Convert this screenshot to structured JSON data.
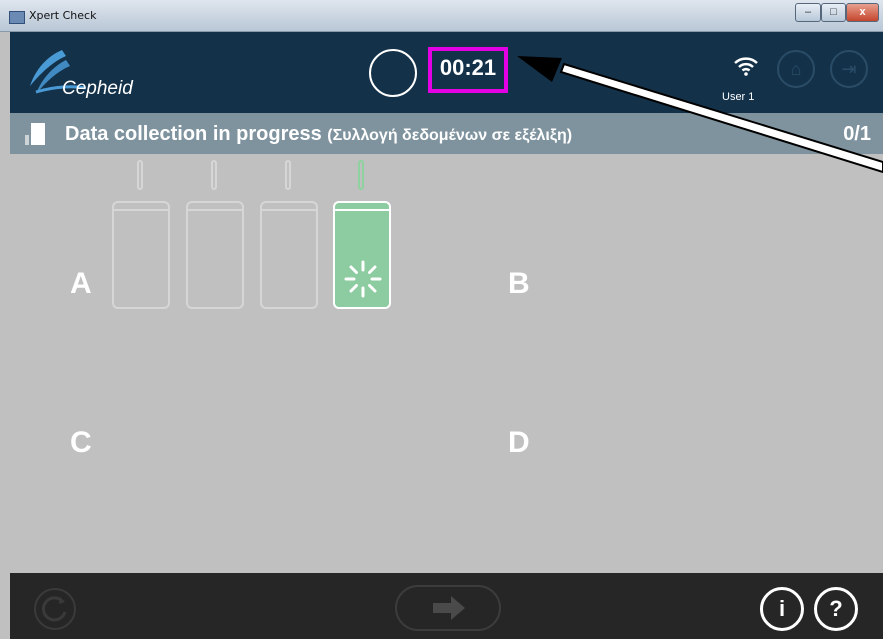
{
  "window": {
    "title": "Xpert Check",
    "minimize_glyph": "–",
    "maximize_glyph": "□",
    "close_glyph": "x"
  },
  "header": {
    "logo_text": "Cepheid",
    "timer": "00:21",
    "user": "User 1",
    "home_icon": "home-icon",
    "exit_icon": "exit-icon",
    "home_glyph": "⌂",
    "exit_glyph": "⇥"
  },
  "status": {
    "title": "Data collection in progress",
    "subtitle": "(Συλλογή δεδομένων σε εξέλιξη)",
    "count": "0/1"
  },
  "quadrants": {
    "a": "A",
    "b": "B",
    "c": "C",
    "d": "D"
  },
  "modules": [
    {
      "state": "empty"
    },
    {
      "state": "empty"
    },
    {
      "state": "empty"
    },
    {
      "state": "in-progress"
    }
  ],
  "footer": {
    "info_label": "i",
    "help_label": "?"
  },
  "colors": {
    "header_bg": "#13324a",
    "status_bg": "#7f939f",
    "main_bg": "#c0c0c0",
    "active_module": "#8ccca0",
    "highlight_box": "#e400e4",
    "footer_bg": "#262626"
  }
}
